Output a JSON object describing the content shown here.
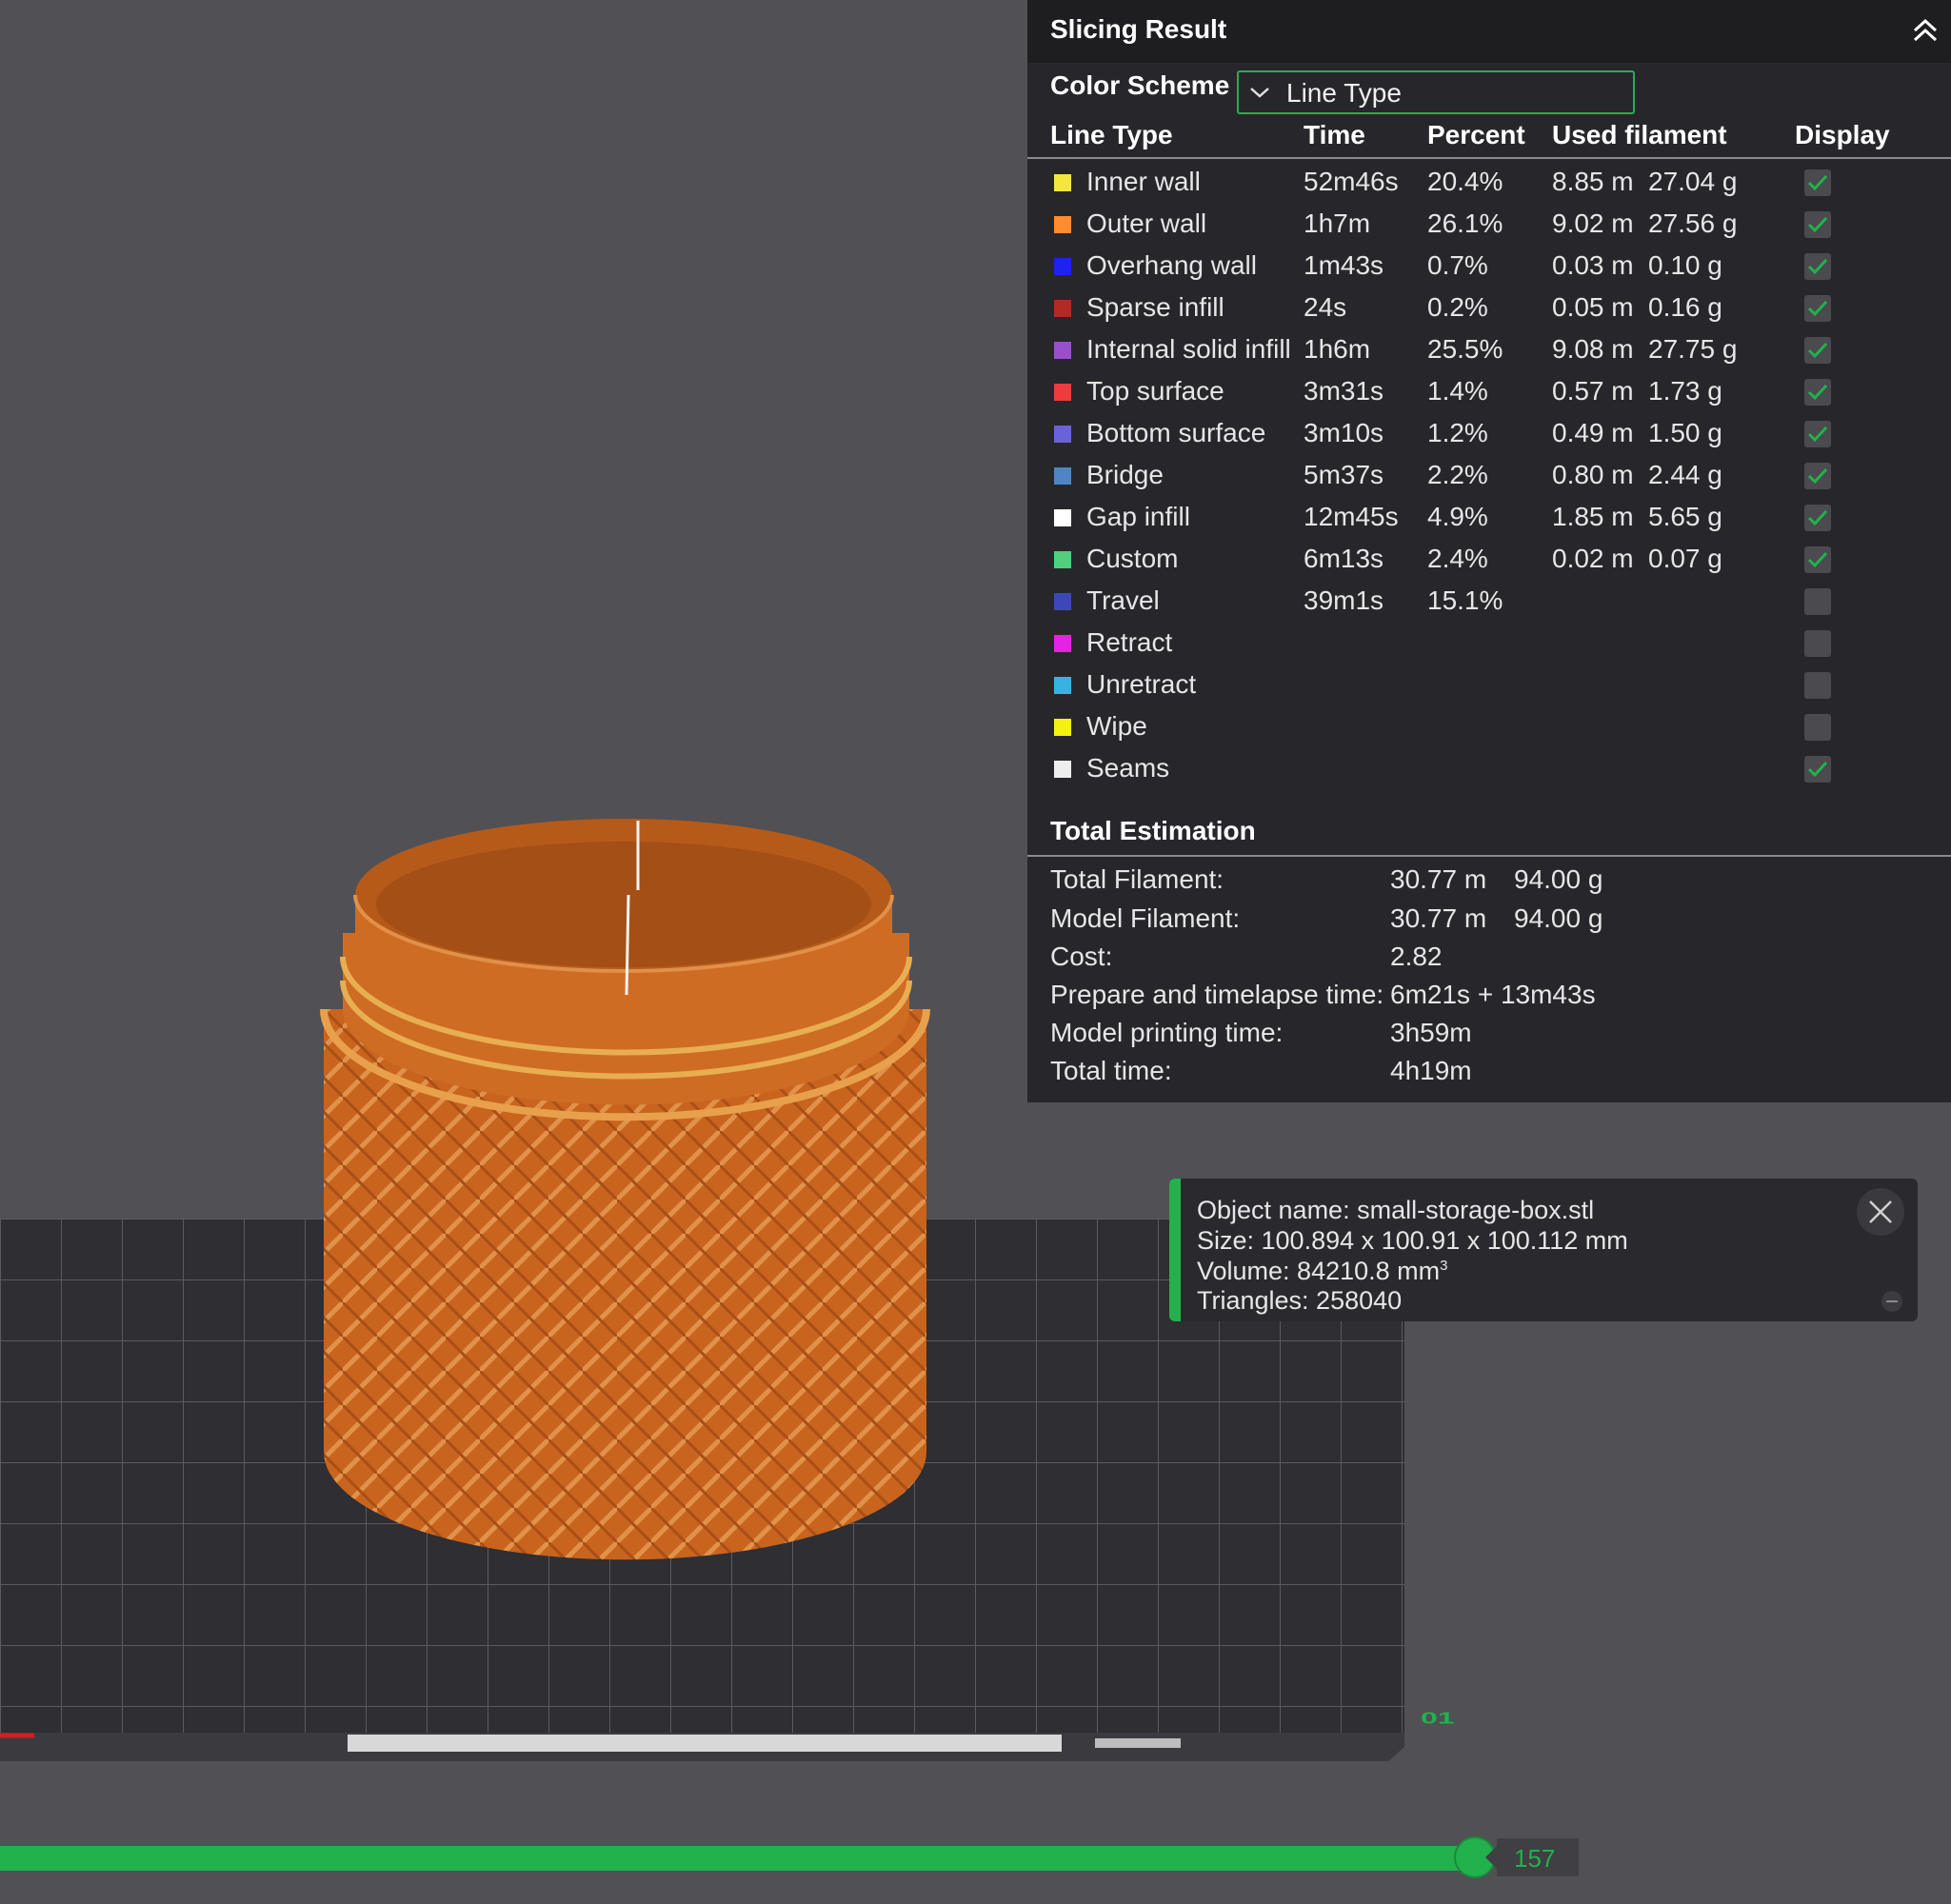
{
  "panel": {
    "title": "Slicing Result",
    "color_scheme_label": "Color Scheme",
    "color_scheme_value": "Line Type",
    "headers": [
      "Line Type",
      "Time",
      "Percent",
      "Used filament",
      "Display"
    ],
    "rows": [
      {
        "name": "Inner wall",
        "color": "#f5e63c",
        "time": "52m46s",
        "percent": "20.4%",
        "length": "8.85 m",
        "weight": "27.04 g",
        "display": true
      },
      {
        "name": "Outer wall",
        "color": "#ff8c2e",
        "time": "1h7m",
        "percent": "26.1%",
        "length": "9.02 m",
        "weight": "27.56 g",
        "display": true
      },
      {
        "name": "Overhang wall",
        "color": "#1e22f0",
        "time": "1m43s",
        "percent": "0.7%",
        "length": "0.03 m",
        "weight": "0.10 g",
        "display": true
      },
      {
        "name": "Sparse infill",
        "color": "#b32a22",
        "time": "24s",
        "percent": "0.2%",
        "length": "0.05 m",
        "weight": "0.16 g",
        "display": true
      },
      {
        "name": "Internal solid infill",
        "color": "#9b4fc8",
        "time": "1h6m",
        "percent": "25.5%",
        "length": "9.08 m",
        "weight": "27.75 g",
        "display": true
      },
      {
        "name": "Top surface",
        "color": "#ef3b3b",
        "time": "3m31s",
        "percent": "1.4%",
        "length": "0.57 m",
        "weight": "1.73 g",
        "display": true
      },
      {
        "name": "Bottom surface",
        "color": "#6a62d8",
        "time": "3m10s",
        "percent": "1.2%",
        "length": "0.49 m",
        "weight": "1.50 g",
        "display": true
      },
      {
        "name": "Bridge",
        "color": "#4d86c2",
        "time": "5m37s",
        "percent": "2.2%",
        "length": "0.80 m",
        "weight": "2.44 g",
        "display": true
      },
      {
        "name": "Gap infill",
        "color": "#ffffff",
        "time": "12m45s",
        "percent": "4.9%",
        "length": "1.85 m",
        "weight": "5.65 g",
        "display": true
      },
      {
        "name": "Custom",
        "color": "#4fd07c",
        "time": "6m13s",
        "percent": "2.4%",
        "length": "0.02 m",
        "weight": "0.07 g",
        "display": true
      },
      {
        "name": "Travel",
        "color": "#3c48b8",
        "time": "39m1s",
        "percent": "15.1%",
        "length": "",
        "weight": "",
        "display": false
      },
      {
        "name": "Retract",
        "color": "#e522e5",
        "time": "",
        "percent": "",
        "length": "",
        "weight": "",
        "display": false
      },
      {
        "name": "Unretract",
        "color": "#36b4e0",
        "time": "",
        "percent": "",
        "length": "",
        "weight": "",
        "display": false
      },
      {
        "name": "Wipe",
        "color": "#f5f012",
        "time": "",
        "percent": "",
        "length": "",
        "weight": "",
        "display": false
      },
      {
        "name": "Seams",
        "color": "#eeeeee",
        "time": "",
        "percent": "",
        "length": "",
        "weight": "",
        "display": true
      }
    ],
    "total": {
      "title": "Total Estimation",
      "rows": [
        {
          "label": "Total Filament:",
          "v1": "30.77 m",
          "v2": "94.00 g"
        },
        {
          "label": "Model Filament:",
          "v1": "30.77 m",
          "v2": "94.00 g"
        },
        {
          "label": "Cost:",
          "v1": "2.82",
          "v2": ""
        },
        {
          "label": "Prepare and timelapse time:",
          "v1": "6m21s + 13m43s",
          "v2": ""
        },
        {
          "label": "Model printing time:",
          "v1": "3h59m",
          "v2": ""
        },
        {
          "label": "Total time:",
          "v1": "4h19m",
          "v2": ""
        }
      ]
    }
  },
  "object_info": {
    "name_line": "Object name: small-storage-box.stl",
    "size_line": "Size: 100.894 x 100.91 x 100.112 mm",
    "volume_line_prefix": "Volume: 84210.8 mm",
    "volume_superscript": "3",
    "triangles_line": "Triangles: 258040"
  },
  "slider": {
    "value": "157",
    "fraction": 0.9
  },
  "bed": {
    "plate_label": "01"
  },
  "colors": {
    "accent": "#22b14c",
    "panel_bg": "#27272b",
    "viewport_bg": "#505055",
    "print": "#c8641e"
  }
}
